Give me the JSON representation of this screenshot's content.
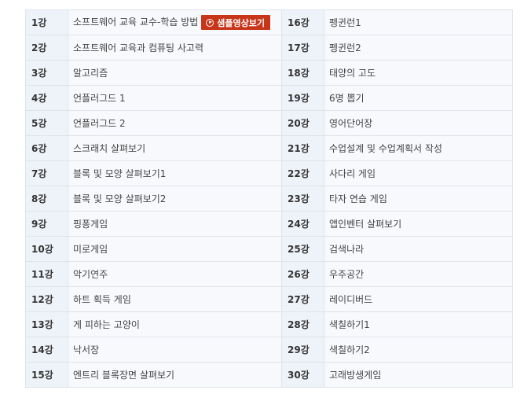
{
  "sample_button_label": "샘플영상보기",
  "lessons_left": [
    {
      "num": "1강",
      "title": "소프트웨어 교육 교수-학습 방법"
    },
    {
      "num": "2강",
      "title": "소프트웨어 교육과 컴퓨팅 사고력"
    },
    {
      "num": "3강",
      "title": "알고리즘"
    },
    {
      "num": "4강",
      "title": "언플러그드 1"
    },
    {
      "num": "5강",
      "title": "언플러그드 2"
    },
    {
      "num": "6강",
      "title": "스크래치 살펴보기"
    },
    {
      "num": "7강",
      "title": "블록 및 모양 살펴보기1"
    },
    {
      "num": "8강",
      "title": "블록 및 모양 살펴보기2"
    },
    {
      "num": "9강",
      "title": "핑퐁게임"
    },
    {
      "num": "10강",
      "title": "미로게임"
    },
    {
      "num": "11강",
      "title": "악기연주"
    },
    {
      "num": "12강",
      "title": "하트 획득 게임"
    },
    {
      "num": "13강",
      "title": "게 피하는 고양이"
    },
    {
      "num": "14강",
      "title": "낙서장"
    },
    {
      "num": "15강",
      "title": "엔트리 블록장면 살펴보기"
    }
  ],
  "lessons_right": [
    {
      "num": "16강",
      "title": "펭귄런1"
    },
    {
      "num": "17강",
      "title": "펭귄런2"
    },
    {
      "num": "18강",
      "title": "태양의 고도"
    },
    {
      "num": "19강",
      "title": "6명 뽑기"
    },
    {
      "num": "20강",
      "title": "영어단어장"
    },
    {
      "num": "21강",
      "title": "수업설계 및 수업계획서 작성"
    },
    {
      "num": "22강",
      "title": "사다리 게임"
    },
    {
      "num": "23강",
      "title": "타자 연습 게임"
    },
    {
      "num": "24강",
      "title": "앱인벤터 살펴보기"
    },
    {
      "num": "25강",
      "title": "검색나라"
    },
    {
      "num": "26강",
      "title": "우주공간"
    },
    {
      "num": "27강",
      "title": "레이디버드"
    },
    {
      "num": "28강",
      "title": "색칠하기1"
    },
    {
      "num": "29강",
      "title": "색칠하기2"
    },
    {
      "num": "30강",
      "title": "고래방생게임"
    }
  ]
}
